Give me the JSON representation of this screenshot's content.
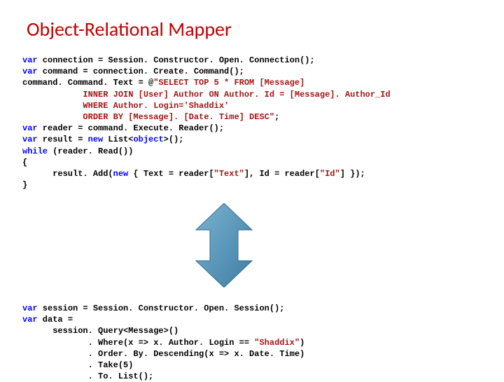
{
  "title": "Object-Relational Mapper",
  "code1": {
    "l1a": "var",
    "l1b": " connection = Session. Constructor. Open. Connection();",
    "l2a": "var",
    "l2b": " command = connection. Create. Command();",
    "l3": "command. Command. Text = @",
    "l3s": "\"SELECT TOP 5 * FROM [Message]",
    "l4s": "            INNER JOIN [User] Author ON Author. Id = [Message]. Author_Id",
    "l5s": "            WHERE Author. Login='Shaddix'",
    "l6s": "            ORDER BY [Message]. [Date. Time] DESC\"",
    "l6b": ";",
    "l7a": "var",
    "l7b": " reader = command. Execute. Reader();",
    "l8a": "var",
    "l8b": " result = ",
    "l8c": "new",
    "l8d": " List<",
    "l8e": "object",
    "l8f": ">();",
    "l9a": "while",
    "l9b": " (reader. Read())",
    "l10": "{",
    "l11a": "      result. Add(",
    "l11b": "new",
    "l11c": " { Text = reader[",
    "l11d": "\"Text\"",
    "l11e": "], Id = reader[",
    "l11f": "\"Id\"",
    "l11g": "] });",
    "l12": "}"
  },
  "code2": {
    "l1a": "var",
    "l1b": " session = Session. Constructor. Open. Session();",
    "l2a": "var",
    "l2b": " data =",
    "l3": "      session. Query<Message>()",
    "l4a": "             . Where(x => x. Author. Login == ",
    "l4b": "\"Shaddix\"",
    "l4c": ")",
    "l5": "             . Order. By. Descending(x => x. Date. Time)",
    "l6": "             . Take(5)",
    "l7": "             . To. List();"
  }
}
